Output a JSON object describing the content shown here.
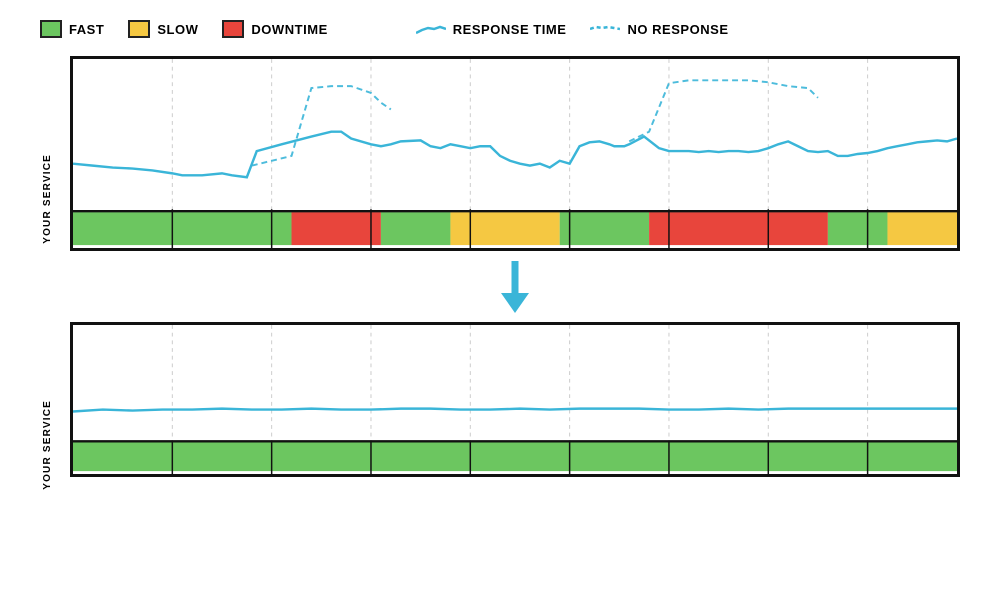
{
  "legend": {
    "items": [
      {
        "label": "FAST",
        "type": "color",
        "color": "#6cc660",
        "border": "#222"
      },
      {
        "label": "SLOW",
        "type": "color",
        "color": "#f5c842",
        "border": "#222"
      },
      {
        "label": "DOWNTIME",
        "type": "color",
        "color": "#e8453c",
        "border": "#222"
      },
      {
        "label": "RESPONSE TIME",
        "type": "line",
        "style": "solid"
      },
      {
        "label": "NO RESPONSE",
        "type": "line",
        "style": "dashed"
      }
    ]
  },
  "chart1": {
    "label": "YOUR SERVICE"
  },
  "chart2": {
    "label": "YOUR SERVICE"
  }
}
